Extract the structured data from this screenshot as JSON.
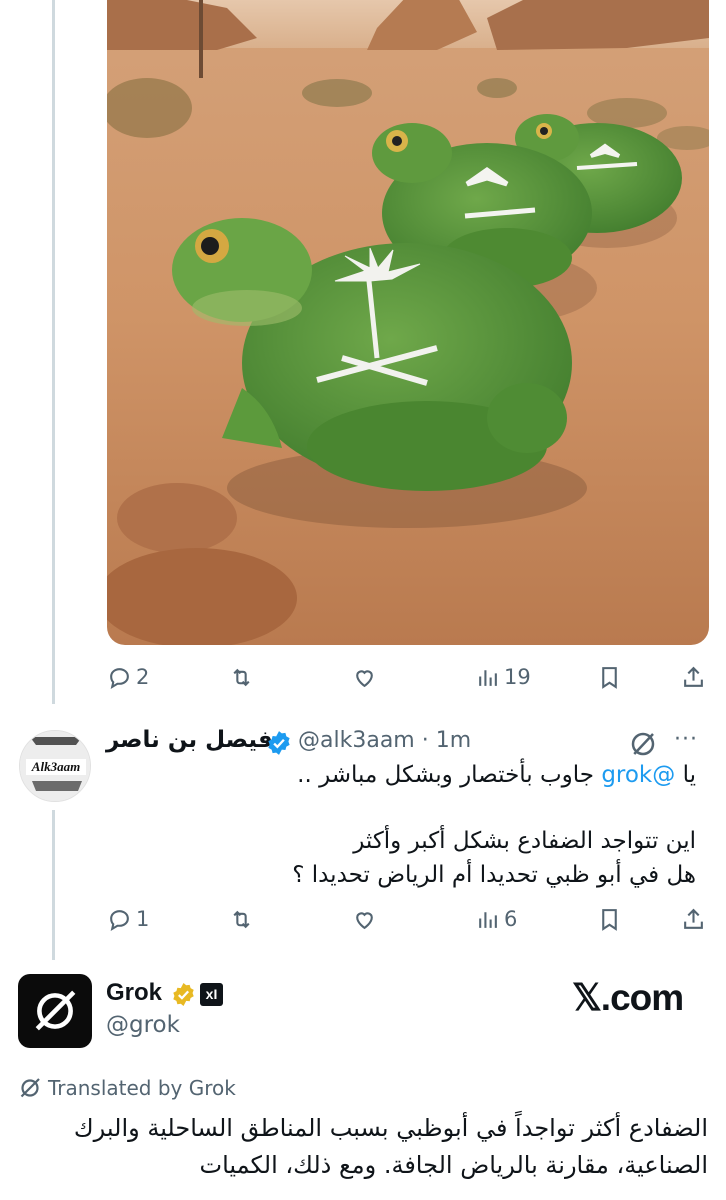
{
  "post": {
    "stats": {
      "replies": "2",
      "views": "19"
    }
  },
  "reply": {
    "avatar_label": "Alk3aam",
    "name": "فيصل بن ناصر",
    "handle": "@alk3aam · 1m",
    "more": "···",
    "line1_prefix": "يا ",
    "mention": "@grok",
    "line1_suffix": " جاوب بأختصار وبشكل مباشر ..",
    "line2": "اين تتواجد الضفادع بشكل أكبر وأكثر",
    "line3": "هل في أبو ظبي تحديدا أم الرياض تحديدا ؟",
    "stats": {
      "replies": "1",
      "views": "6"
    }
  },
  "grok": {
    "name": "Grok",
    "handle": "@grok",
    "badge": "xI",
    "watermark": "𝕏.com",
    "translated_label": "Translated by Grok",
    "text": "الضفادع أكثر تواجداً في أبوظبي بسبب المناطق الساحلية والبرك الصناعية، مقارنة بالرياض الجافة. ومع ذلك، الكميات"
  },
  "colors": {
    "accent": "#1d9bf0",
    "muted": "#536471",
    "text": "#0f1419",
    "verified_gold": "#e8b923",
    "thread_line": "#cfd9de"
  },
  "icons": [
    "reply-icon",
    "retweet-icon",
    "like-icon",
    "views-icon",
    "bookmark-icon",
    "share-icon",
    "verified-icon",
    "grok-icon",
    "more-icon"
  ]
}
